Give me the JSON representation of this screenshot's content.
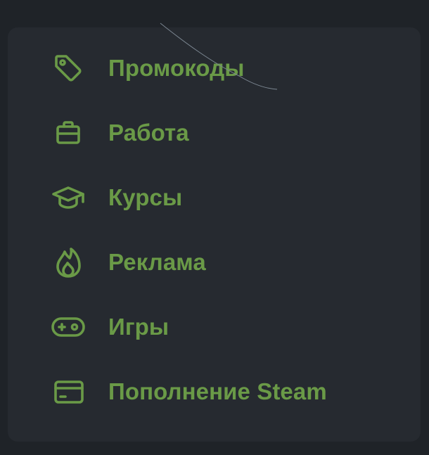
{
  "theme": {
    "accent": "#6a9a47",
    "panel_background": "#262a30",
    "page_background": "#1f2328"
  },
  "menu": {
    "items": [
      {
        "label": "Промокоды",
        "icon": "tag-icon"
      },
      {
        "label": "Работа",
        "icon": "briefcase-icon"
      },
      {
        "label": "Курсы",
        "icon": "graduation-cap-icon"
      },
      {
        "label": "Реклама",
        "icon": "flame-icon"
      },
      {
        "label": "Игры",
        "icon": "gamepad-icon"
      },
      {
        "label": "Пополнение Steam",
        "icon": "credit-card-icon"
      }
    ]
  }
}
